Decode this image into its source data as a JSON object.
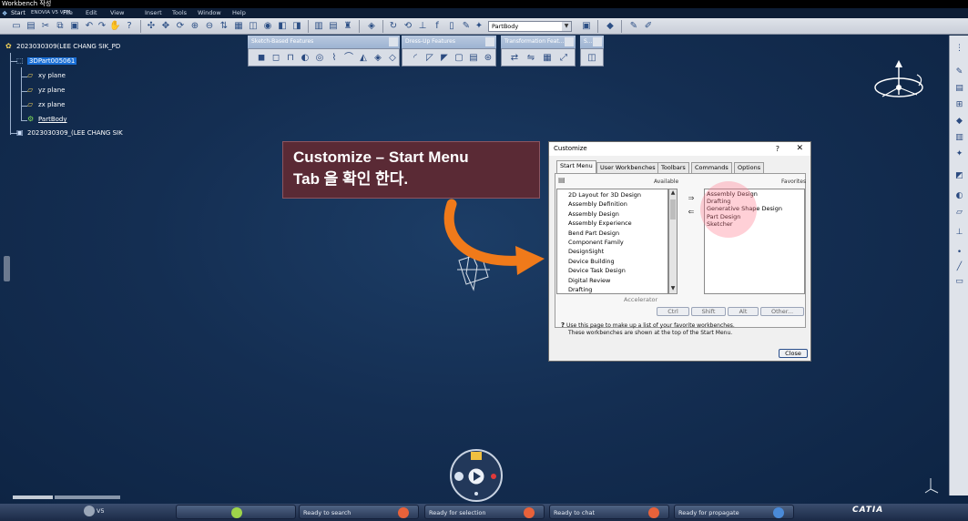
{
  "window": {
    "title": "Workbench 작성"
  },
  "menu": [
    "Start",
    "ENOVIA V5 VPM",
    "File",
    "Edit",
    "View",
    "Insert",
    "Tools",
    "Window",
    "Help"
  ],
  "toolbar": {
    "workbench_select": "PartBody"
  },
  "floating_toolbars": [
    {
      "title": "Sketch-Based Features"
    },
    {
      "title": "Dress-Up Features"
    },
    {
      "title": "Transformation Feat..."
    },
    {
      "title": "S..."
    }
  ],
  "tree": {
    "root": "2023030309(LEE CHANG SIK_PD",
    "part": "3DPart005061",
    "planes": [
      "xy plane",
      "yz plane",
      "zx plane"
    ],
    "body": "PartBody",
    "product": "2023030309_(LEE CHANG SIK"
  },
  "callout": {
    "line1": "Customize – Start Menu",
    "line2": "Tab 을 확인 한다."
  },
  "dialog": {
    "title": "Customize",
    "help": "?",
    "close": "✕",
    "tabs": [
      "Start Menu",
      "User Workbenches",
      "Toolbars",
      "Commands",
      "Options"
    ],
    "available_label": "Available",
    "favorites_label": "Favorites",
    "available": [
      "2D Layout for 3D Design",
      "Assembly Definition",
      "Assembly Design",
      "Assembly Experience",
      "Bend Part Design",
      "Component Family",
      "DesignSight",
      "Device Building",
      "Device Task Design",
      "Digital Review",
      "Drafting"
    ],
    "favorites": [
      "Assembly Design",
      "Drafting",
      "Generative Shape Design",
      "Part Design",
      "Sketcher"
    ],
    "accelerator_label": "Accelerator",
    "accelerator_buttons": [
      "Ctrl",
      "Shift",
      "Alt",
      "Other..."
    ],
    "help_line1": "Use this page to make up a list of your favorite workbenches.",
    "help_line2": "These workbenches are shown at the top of the Start Menu.",
    "close_button": "Close"
  },
  "taskbar": {
    "items": [
      "V5",
      "",
      "Ready to search",
      "Ready for selection",
      "Ready to chat",
      "Ready for propagate"
    ],
    "brand": "CATIA"
  },
  "colors": {
    "background": "#142e52",
    "callout_bg": "#5a2a35",
    "arrow": "#f07a1a",
    "selection": "#1a6fd6",
    "highlight": "#ff7a8c"
  }
}
